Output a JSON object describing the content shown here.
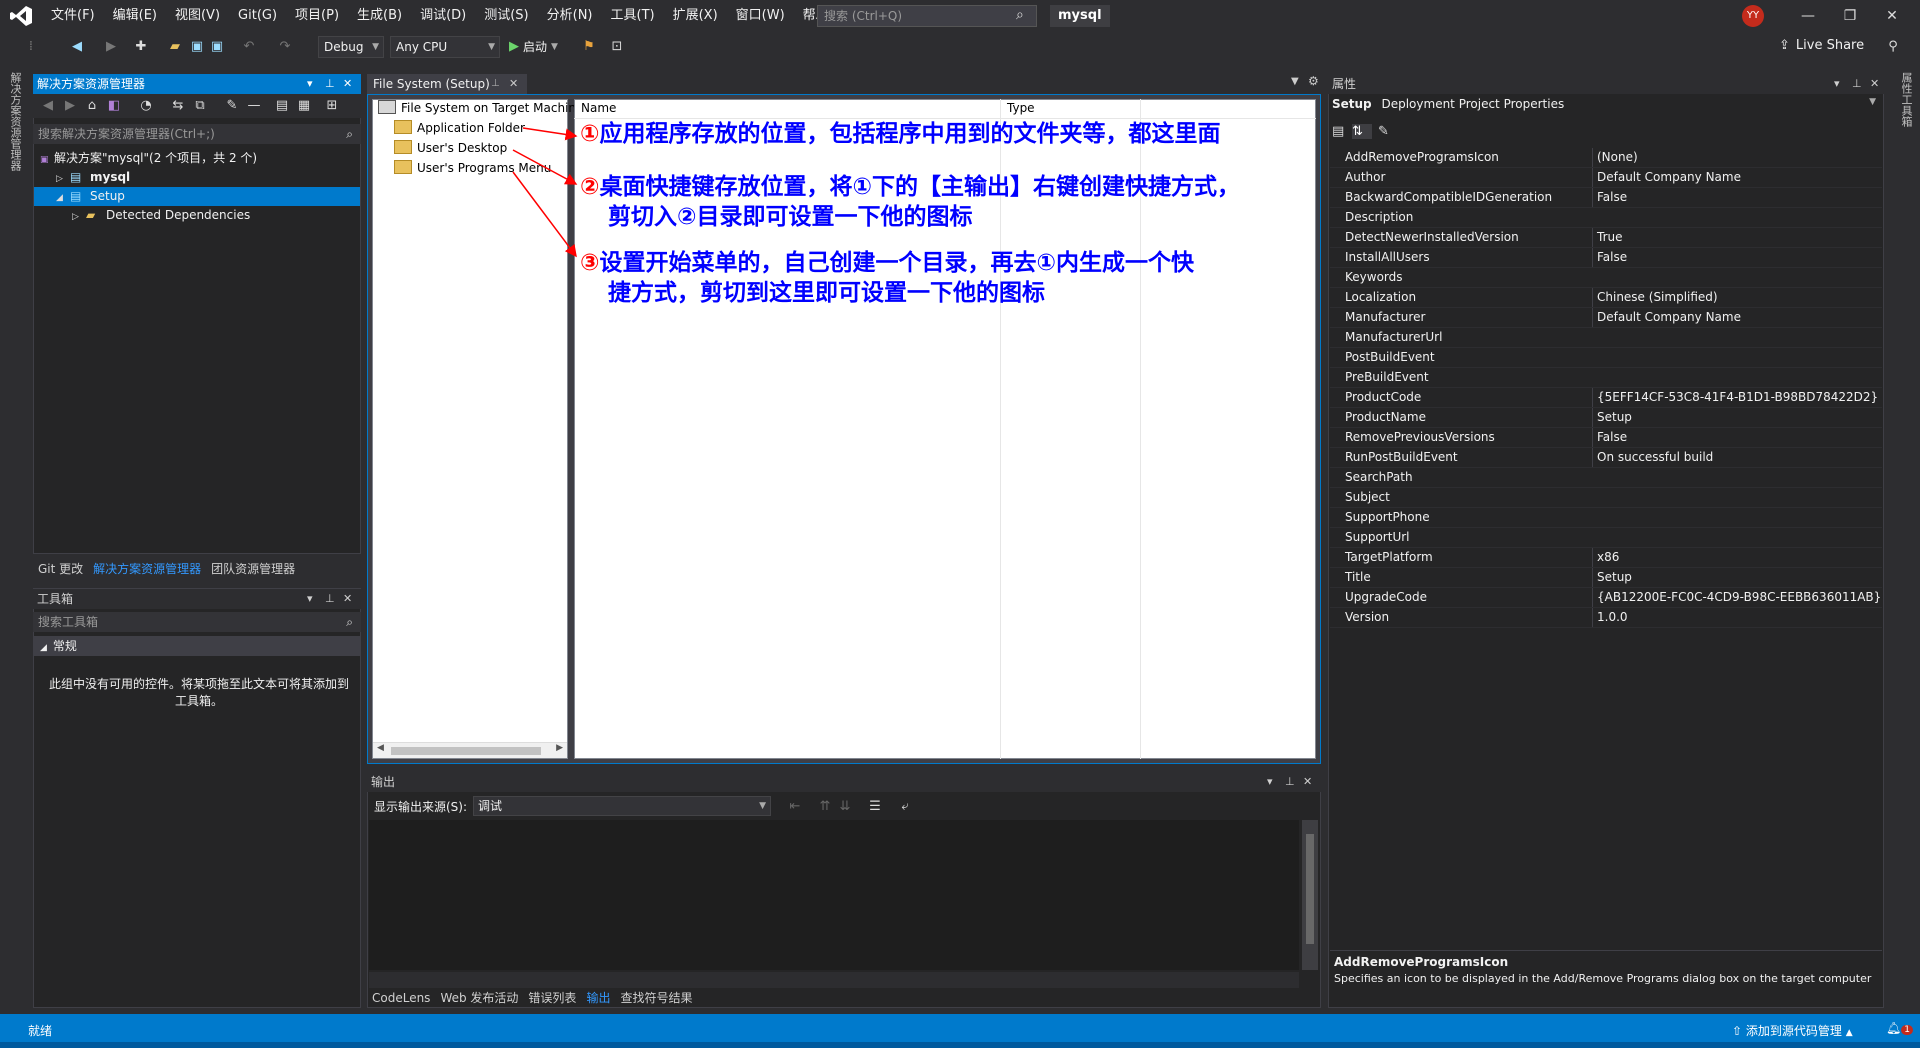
{
  "menu": [
    "文件(F)",
    "编辑(E)",
    "视图(V)",
    "Git(G)",
    "项目(P)",
    "生成(B)",
    "调试(D)",
    "测试(S)",
    "分析(N)",
    "工具(T)",
    "扩展(X)",
    "窗口(W)",
    "帮助(H)"
  ],
  "search_placeholder": "搜索 (Ctrl+Q)",
  "solution_name": "mysql",
  "avatar_initials": "YY",
  "toolbar": {
    "config": "Debug",
    "platform": "Any CPU",
    "start": "启动",
    "live_share": "Live Share"
  },
  "left_strip_label": "解决方案资源管理器",
  "right_strip_label": "属性工具箱",
  "solution_explorer": {
    "title": "解决方案资源管理器",
    "search": "搜索解决方案资源管理器(Ctrl+;)",
    "tree": [
      {
        "label": "解决方案\"mysql\"(2 个项目，共 2 个)",
        "indent": 0,
        "bold": false,
        "selected": false
      },
      {
        "label": "mysql",
        "indent": 1,
        "bold": true,
        "selected": false
      },
      {
        "label": "Setup",
        "indent": 1,
        "bold": false,
        "selected": true
      },
      {
        "label": "Detected Dependencies",
        "indent": 2,
        "bold": false,
        "selected": false
      }
    ],
    "tabs": [
      "Git 更改",
      "解决方案资源管理器",
      "团队资源管理器"
    ]
  },
  "toolbox": {
    "title": "工具箱",
    "search": "搜索工具箱",
    "group": "常规",
    "empty_text": "此组中没有可用的控件。将某项拖至此文本可将其添加到工具箱。"
  },
  "document": {
    "tab_title": "File System (Setup)",
    "tree": [
      "File System on Target Machin",
      "Application Folder",
      "User's Desktop",
      "User's Programs Menu"
    ],
    "columns": [
      "Name",
      "Type"
    ],
    "annotations": [
      {
        "num": "①",
        "lines": [
          "应用程序存放的位置，包括程序中用到的文件夹等，都这里面"
        ]
      },
      {
        "num": "②",
        "lines": [
          "桌面快捷键存放位置，将①下的【主输出】右键创建快捷方式，",
          "剪切入②目录即可设置一下他的图标"
        ]
      },
      {
        "num": "③",
        "lines": [
          "设置开始菜单的，自己创建一个目录，再去①内生成一个快",
          "捷方式，剪切到这里即可设置一下他的图标"
        ]
      }
    ]
  },
  "output": {
    "title": "输出",
    "source_label": "显示输出来源(S):",
    "source_value": "调试",
    "tabs": [
      "CodeLens",
      "Web 发布活动",
      "错误列表",
      "输出",
      "查找符号结果"
    ]
  },
  "properties": {
    "title": "属性",
    "object": "Setup",
    "object_type": "Deployment Project Properties",
    "rows": [
      [
        "AddRemoveProgramsIcon",
        "(None)"
      ],
      [
        "Author",
        "Default Company Name"
      ],
      [
        "BackwardCompatibleIDGeneration",
        "False"
      ],
      [
        "Description",
        ""
      ],
      [
        "DetectNewerInstalledVersion",
        "True"
      ],
      [
        "InstallAllUsers",
        "False"
      ],
      [
        "Keywords",
        ""
      ],
      [
        "Localization",
        "Chinese (Simplified)"
      ],
      [
        "Manufacturer",
        "Default Company Name"
      ],
      [
        "ManufacturerUrl",
        ""
      ],
      [
        "PostBuildEvent",
        ""
      ],
      [
        "PreBuildEvent",
        ""
      ],
      [
        "ProductCode",
        "{5EFF14CF-53C8-41F4-B1D1-B98BD78422D2}"
      ],
      [
        "ProductName",
        "Setup"
      ],
      [
        "RemovePreviousVersions",
        "False"
      ],
      [
        "RunPostBuildEvent",
        "On successful build"
      ],
      [
        "SearchPath",
        ""
      ],
      [
        "Subject",
        ""
      ],
      [
        "SupportPhone",
        ""
      ],
      [
        "SupportUrl",
        ""
      ],
      [
        "TargetPlatform",
        "x86"
      ],
      [
        "Title",
        "Setup"
      ],
      [
        "UpgradeCode",
        "{AB12200E-FC0C-4CD9-B98C-EEBB636011AB}"
      ],
      [
        "Version",
        "1.0.0"
      ]
    ],
    "desc_title": "AddRemoveProgramsIcon",
    "desc_text": "Specifies an icon to be displayed in the Add/Remove Programs dialog box on the target computer"
  },
  "status": {
    "text": "就绪",
    "source_control": "添加到源代码管理",
    "notifications": "1"
  },
  "colors": {
    "accent": "#007acc",
    "annotation_text": "#0000ff",
    "annotation_number": "#ff0000",
    "arrow": "#ff0000"
  }
}
